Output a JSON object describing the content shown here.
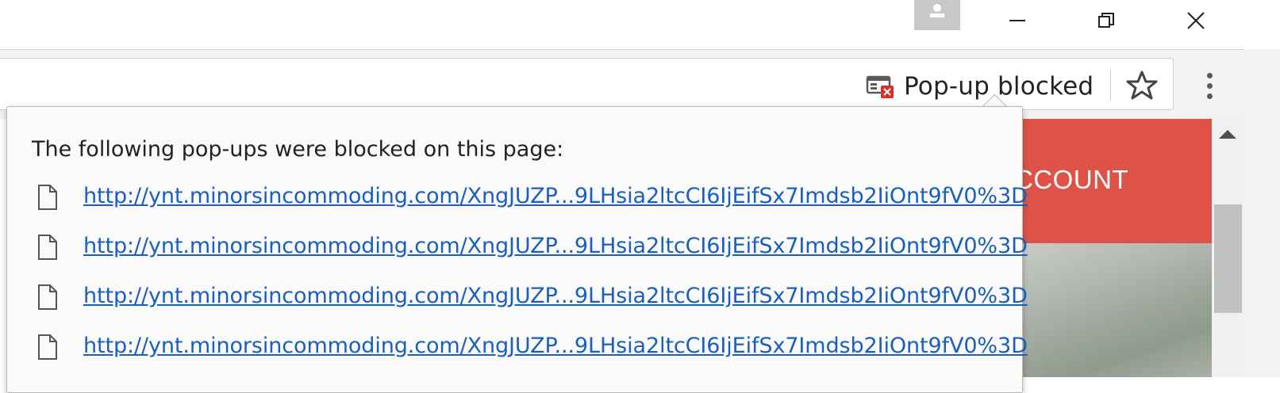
{
  "window": {
    "profile_icon": "person-icon",
    "controls": [
      "minimize-icon",
      "restore-icon",
      "close-icon"
    ]
  },
  "toolbar": {
    "popup_indicator_label": "Pop-up blocked",
    "popup_indicator_icon": "popup-blocked-icon",
    "bookmark_icon": "star-icon",
    "menu_icon": "more-vert-icon"
  },
  "page": {
    "banner_text": "CCOUNT",
    "banner_color": "#dd5347"
  },
  "bubble": {
    "heading": "The following pop-ups were blocked on this page:",
    "items": [
      {
        "url": "http://ynt.minorsincommoding.com/XngJUZP...9LHsia2ltcCI6IjEifSx7Imdsb2IiOnt9fV0%3D"
      },
      {
        "url": "http://ynt.minorsincommoding.com/XngJUZP...9LHsia2ltcCI6IjEifSx7Imdsb2IiOnt9fV0%3D"
      },
      {
        "url": "http://ynt.minorsincommoding.com/XngJUZP...9LHsia2ltcCI6IjEifSx7Imdsb2IiOnt9fV0%3D"
      },
      {
        "url": "http://ynt.minorsincommoding.com/XngJUZP...9LHsia2ltcCI6IjEifSx7Imdsb2IiOnt9fV0%3D"
      }
    ],
    "link_color": "#1a5fbd"
  }
}
